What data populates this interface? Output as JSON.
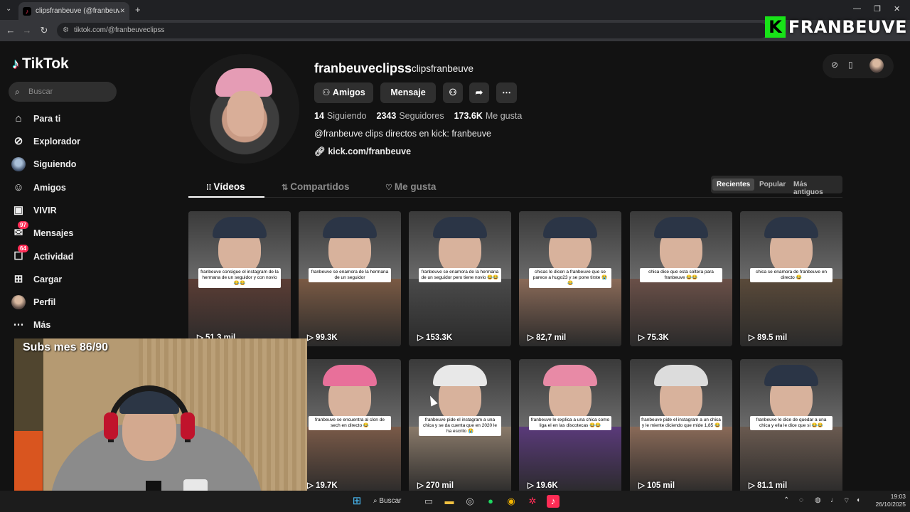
{
  "browser": {
    "tab_title": "clipsfranbeuve (@franbeuveclip",
    "tab_close": "✕",
    "new_tab": "+",
    "url": "tiktok.com/@franbeuveclipss"
  },
  "overlay_logo": {
    "letter": "K",
    "name": "FRANBEUVE"
  },
  "sidebar": {
    "logo": "TikTok",
    "search_placeholder": "Buscar",
    "items": [
      {
        "label": "Para ti",
        "icon": "home-icon"
      },
      {
        "label": "Explorador",
        "icon": "compass-icon"
      },
      {
        "label": "Siguiendo",
        "icon": "following-avatar"
      },
      {
        "label": "Amigos",
        "icon": "friends-icon"
      },
      {
        "label": "VIVIR",
        "icon": "live-icon"
      },
      {
        "label": "Mensajes",
        "icon": "messages-icon",
        "badge": "97"
      },
      {
        "label": "Actividad",
        "icon": "activity-icon",
        "badge": "64"
      },
      {
        "label": "Cargar",
        "icon": "upload-icon"
      },
      {
        "label": "Perfil",
        "icon": "profile-avatar"
      },
      {
        "label": "Más",
        "icon": "more-icon"
      }
    ]
  },
  "profile": {
    "username": "franbeuveclipss",
    "nickname": "clipsfranbeuve",
    "friends_button": "Amigos",
    "message_button": "Mensaje",
    "following_count": "14",
    "following_label": "Siguiendo",
    "followers_count": "2343",
    "followers_label": "Seguidores",
    "likes_count": "173.6K",
    "likes_label": "Me gusta",
    "bio": "@franbeuve clips directos en kick: franbeuve",
    "link": "kick.com/franbeuve"
  },
  "tabs": {
    "videos": "Vídeos",
    "shared": "Compartidos",
    "liked": "Me gusta"
  },
  "sort": {
    "recent": "Recientes",
    "popular": "Popular",
    "oldest": "Más antiguos"
  },
  "videos": [
    {
      "views": "51,3 mil",
      "caption": "franbeuve consigue el instagram de la hermana de un seguidor y con novio😂😂",
      "hat": "#2b3546",
      "bottom": "#5b3d35"
    },
    {
      "views": "99.3K",
      "caption": "franbeuve se enamora de la hermana de un seguidor",
      "hat": "#2b3546",
      "bottom": "#7a5a44"
    },
    {
      "views": "153.3K",
      "caption": "franbeuve se enamora de la hermana de un seguidor pero tiene novio 😂😂",
      "hat": "#2b3546",
      "bottom": "#4a4a4a"
    },
    {
      "views": "82,7 mil",
      "caption": "chicas le dicen a franbeuve que se parece a hugo23 y se pone tirste 😭😂",
      "hat": "#2b3546",
      "bottom": "#8a6a58"
    },
    {
      "views": "75.3K",
      "caption": "chica dice que esta soltera para franbeuve 😂😂",
      "hat": "#2b3546",
      "bottom": "#6a5048"
    },
    {
      "views": "89.5 mil",
      "caption": "chica se enamora de franbeuve en directo 😂",
      "hat": "#2b3546",
      "bottom": "#5a4a3a"
    },
    {
      "views": "",
      "caption": "",
      "hat": "#2b3546",
      "bottom": "#3a3a3a"
    },
    {
      "views": "19.7K",
      "caption": "franbeuve se encuentra al clon de sech en directo 😂",
      "hat": "#e8709a",
      "bottom": "#7a5a48"
    },
    {
      "views": "270 mil",
      "caption": "franbeuve pide el instagram a una chica y se da cuenta que en 2020 le ha escrito 😭",
      "hat": "#e8e8e8",
      "bottom": "#8a7a6a"
    },
    {
      "views": "19.6K",
      "caption": "franbeuve le explica a una chica como liga el en las discotecas 😂😂",
      "hat": "#e88aa6",
      "bottom": "#5a3a7a"
    },
    {
      "views": "105 mil",
      "caption": "franbeuve pide el instagram a un chica y le miente diciendo que mide 1,85 😂",
      "hat": "#dcdcdc",
      "bottom": "#8a6a58"
    },
    {
      "views": "81.1 mil",
      "caption": "franbeuve le dice de quedar a una chica y ella le dice que si 😂😂",
      "hat": "#2b3546",
      "bottom": "#6a5a50"
    }
  ],
  "webcam": {
    "subs_text": "Subs mes 86/90"
  },
  "taskbar": {
    "search": "Buscar",
    "time": "19:03",
    "date": "26/10/2025"
  }
}
